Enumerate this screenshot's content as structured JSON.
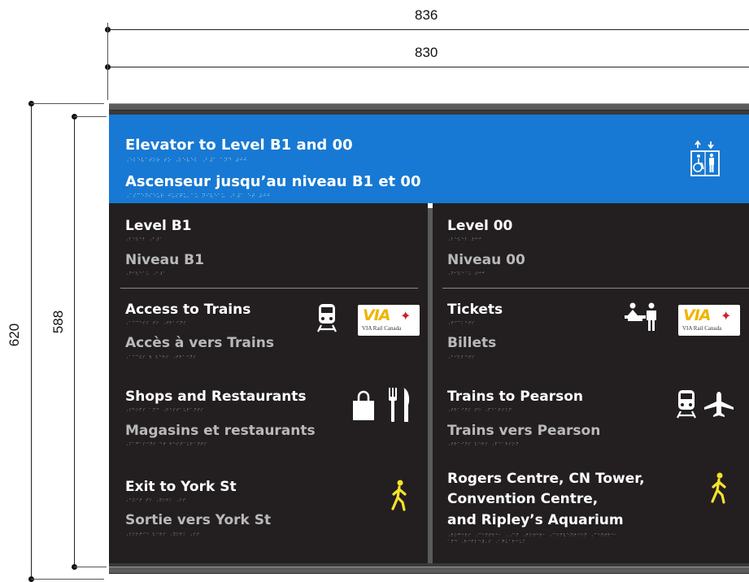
{
  "dimensions": {
    "outer_width": "836",
    "inner_width": "830",
    "outer_height": "620",
    "inner_height": "588"
  },
  "banner": {
    "title_en": "Elevator to Level B1 and 00",
    "braille_en": "⠠⠑⠇⠑⠧⠁⠞⠕⠗ ⠞⠕ ⠠⠇⠑⠧⠑⠇ ⠠⠃⠼⠁ ⠁⠝⠙ ⠼⠚⠚",
    "title_fr": "Ascenseur jusqu’au niveau B1 et 00",
    "braille_fr": "⠠⠁⠎⠉⠑⠝⠎⠑⠥⠗ ⠚⠥⠎⠟⠥⠄⠁⠥ ⠝⠊⠧⠑⠁⠥ ⠠⠃⠼⠁ ⠑⠞ ⠼⠚⠚",
    "icon": "elevator-accessible-icon",
    "color": "#1779d3"
  },
  "left": {
    "level_en": "Level B1",
    "level_br_en": "⠠⠇⠑⠧⠑⠇ ⠠⠃⠼⠁",
    "level_fr": "Niveau B1",
    "level_br_fr": "⠠⠝⠊⠧⠑⠁⠥ ⠠⠃⠼⠁",
    "items": [
      {
        "en": "Access to Trains",
        "br_en": "⠠⠁⠉⠉⠑⠎⠎ ⠞⠕ ⠠⠞⠗⠁⠊⠝⠎",
        "fr": "Accès à vers Trains",
        "br_fr": "⠠⠁⠉⠉⠮⠎ ⠷ ⠧⠑⠗⠎ ⠠⠞⠗⠁⠊⠝⠎",
        "icon": "train-icon",
        "logo_text": "VIA",
        "logo_sub": "VIA Rail Canada"
      },
      {
        "en": "Shops and Restaurants",
        "br_en": "⠠⠎⠓⠕⠏⠎ ⠁⠝⠙ ⠠⠗⠑⠎⠞⠁⠥⠗⠁⠝⠞⠎",
        "fr": "Magasins et restaurants",
        "br_fr": "⠠⠍⠁⠛⠁⠎⠊⠝⠎ ⠑⠞ ⠗⠑⠎⠞⠁⠥⠗⠁⠝⠞⠎",
        "icon": "shopping-bag-icon",
        "icon2": "fork-knife-icon"
      },
      {
        "en": "Exit to York St",
        "br_en": "⠠⠑⠭⠊⠞ ⠞⠕ ⠠⠽⠕⠗⠅ ⠠⠎⠞",
        "fr": "Sortie vers York St",
        "br_fr": "⠠⠎⠕⠗⠞⠊⠑ ⠧⠑⠗⠎ ⠠⠽⠕⠗⠅ ⠠⠎⠞",
        "icon": "pedestrian-icon"
      }
    ]
  },
  "right": {
    "level_en": "Level 00",
    "level_br_en": "⠠⠇⠑⠧⠑⠇ ⠼⠚⠚",
    "level_fr": "Niveau 00",
    "level_br_fr": "⠠⠝⠊⠧⠑⠁⠥ ⠼⠚⠚",
    "items": [
      {
        "en": "Tickets",
        "br_en": "⠠⠞⠊⠉⠅⠑⠞⠎",
        "fr": "Billets",
        "br_fr": "⠠⠃⠊⠇⠇⠑⠞⠎",
        "icon": "ticket-counter-icon",
        "logo_text": "VIA",
        "logo_sub": "VIA Rail Canada"
      },
      {
        "en": "Trains to Pearson",
        "br_en": "⠠⠞⠗⠁⠊⠝⠎ ⠞⠕ ⠠⠏⠑⠁⠗⠎⠕⠝",
        "fr": "Trains vers Pearson",
        "br_fr": "⠠⠞⠗⠁⠊⠝⠎ ⠧⠑⠗⠎ ⠠⠏⠑⠁⠗⠎⠕⠝",
        "icon": "train-icon",
        "icon2": "airplane-icon"
      },
      {
        "en_line1": "Rogers Centre, CN Tower,",
        "en_line2": "Convention Centre,",
        "en_line3": "and Ripley’s Aquarium",
        "br_line1": "⠠⠗⠕⠛⠑⠗⠎ ⠠⠉⠑⠝⠞⠗⠑⠂ ⠠⠠⠉⠝ ⠠⠞⠕⠺⠑⠗⠂ ⠠⠉⠕⠝⠧⠑⠝⠞⠊⠕⠝ ⠠⠉⠑⠝⠞⠗⠑⠂",
        "br_line2": "⠁⠝⠙ ⠠⠗⠊⠏⠇⠑⠽⠄⠎ ⠠⠁⠟⠥⠁⠗⠊⠥⠍",
        "icon": "pedestrian-icon"
      }
    ]
  },
  "colors": {
    "panel": "#231f20",
    "pedestrian": "#f5e32b",
    "via_yellow": "#f0b400",
    "maple_red": "#d01f2d"
  }
}
